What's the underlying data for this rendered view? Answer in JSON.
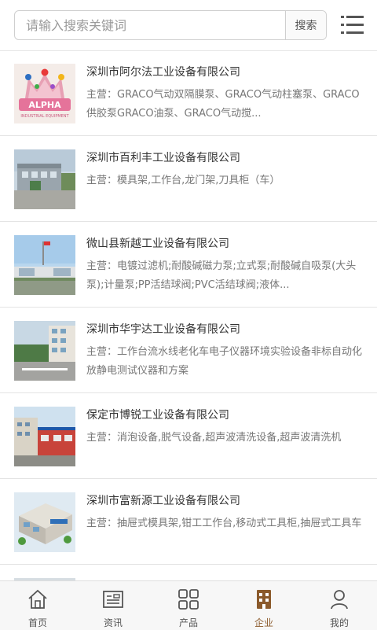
{
  "search": {
    "placeholder": "请输入搜索关键词",
    "button_label": "搜索"
  },
  "companies": [
    {
      "name": "深圳市阿尔法工业设备有限公司",
      "desc": "主营：GRACO气动双隔膜泵、GRACO气动柱塞泵、GRACO供胶泵GRACO油泵、GRACO气动搅..."
    },
    {
      "name": "深圳市百利丰工业设备有限公司",
      "desc": "主营：模具架,工作台,龙门架,刀具柜（车）"
    },
    {
      "name": "微山县新越工业设备有限公司",
      "desc": "主营：电镀过滤机;耐酸碱磁力泵;立式泵;耐酸碱自吸泵(大头泵);计量泵;PP活结球阀;PVC活结球阀;液体..."
    },
    {
      "name": "深圳市华宇达工业设备有限公司",
      "desc": "主营：工作台流水线老化车电子仪器环境实验设备非标自动化放静电测试仪器和方案"
    },
    {
      "name": "保定市博锐工业设备有限公司",
      "desc": "主营：消泡设备,脱气设备,超声波清洗设备,超声波清洗机"
    },
    {
      "name": "深圳市富新源工业设备有限公司",
      "desc": "主营：抽屉式模具架,钳工工作台,移动式工具柜,抽屉式工具车"
    }
  ],
  "thumb_text": {
    "alpha_logo": "ALPHA",
    "alpha_sub": "INDUSTRIAL EQUIPMENT"
  },
  "tabs": [
    {
      "label": "首页",
      "icon": "home-icon"
    },
    {
      "label": "资讯",
      "icon": "news-icon"
    },
    {
      "label": "产品",
      "icon": "grid-icon"
    },
    {
      "label": "企业",
      "icon": "building-icon",
      "active": true
    },
    {
      "label": "我的",
      "icon": "user-icon"
    }
  ],
  "colors": {
    "active_tab": "#8b5a2b",
    "tab_inactive": "#555555"
  }
}
